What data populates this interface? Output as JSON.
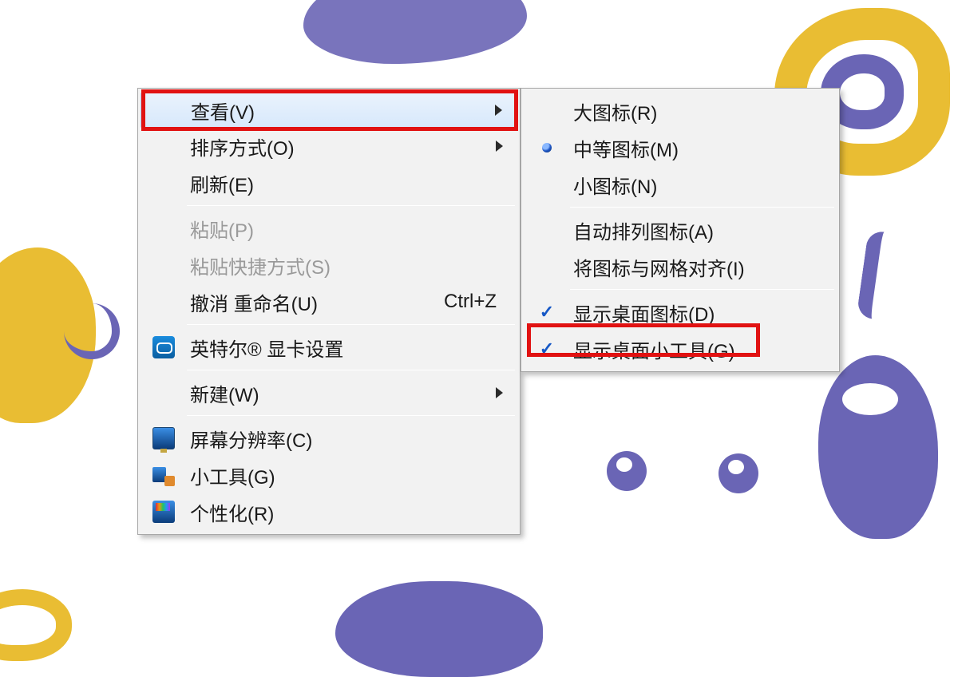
{
  "main_menu": {
    "view": {
      "label": "查看(V)"
    },
    "sort": {
      "label": "排序方式(O)"
    },
    "refresh": {
      "label": "刷新(E)"
    },
    "paste": {
      "label": "粘贴(P)"
    },
    "paste_short": {
      "label": "粘贴快捷方式(S)"
    },
    "undo": {
      "label": "撤消 重命名(U)",
      "shortcut": "Ctrl+Z"
    },
    "intel": {
      "label": "英特尔® 显卡设置"
    },
    "new": {
      "label": "新建(W)"
    },
    "resolution": {
      "label": "屏幕分辨率(C)"
    },
    "gadgets": {
      "label": "小工具(G)"
    },
    "personalize": {
      "label": "个性化(R)"
    }
  },
  "sub_menu": {
    "large": {
      "label": "大图标(R)"
    },
    "medium": {
      "label": "中等图标(M)"
    },
    "small": {
      "label": "小图标(N)"
    },
    "auto": {
      "label": "自动排列图标(A)"
    },
    "align": {
      "label": "将图标与网格对齐(I)"
    },
    "show_icons": {
      "label": "显示桌面图标(D)"
    },
    "show_gadgets": {
      "label": "显示桌面小工具(G)"
    }
  }
}
